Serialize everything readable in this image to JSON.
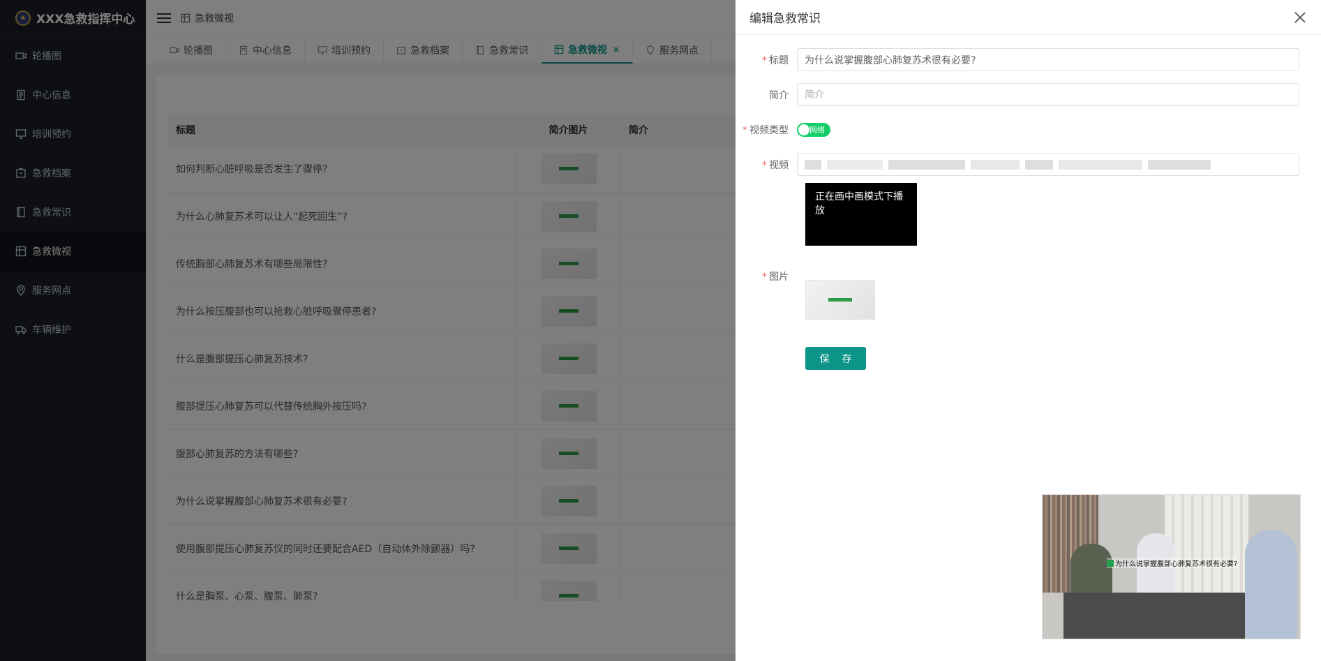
{
  "app": {
    "title": "XXX急救指挥中心"
  },
  "sidebar": {
    "items": [
      {
        "label": "轮播图",
        "icon": "video-icon"
      },
      {
        "label": "中心信息",
        "icon": "document-icon"
      },
      {
        "label": "培训预约",
        "icon": "monitor-icon"
      },
      {
        "label": "急救档案",
        "icon": "box-icon"
      },
      {
        "label": "急救常识",
        "icon": "notebook-icon"
      },
      {
        "label": "急救微视",
        "icon": "grid-icon",
        "active": true
      },
      {
        "label": "服务网点",
        "icon": "location-icon"
      },
      {
        "label": "车辆维护",
        "icon": "truck-icon"
      }
    ]
  },
  "header": {
    "breadcrumb": "急救微视"
  },
  "tabs": [
    {
      "label": "轮播图"
    },
    {
      "label": "中心信息"
    },
    {
      "label": "培训预约"
    },
    {
      "label": "急救档案"
    },
    {
      "label": "急救常识"
    },
    {
      "label": "急救微视",
      "active": true,
      "close": "×"
    },
    {
      "label": "服务网点"
    }
  ],
  "table": {
    "headers": {
      "title": "标题",
      "image": "简介图片",
      "desc": "简介"
    },
    "rows": [
      "如何判断心脏呼吸是否发生了骤停?",
      "为什么心肺复苏术可以让人“起死回生”?",
      "传统胸部心肺复苏术有哪些局限性?",
      "为什么按压腹部也可以抢救心脏呼吸骤停患者?",
      "什么是腹部提压心肺复苏技术?",
      "腹部提压心肺复苏可以代替传统胸外按压吗?",
      "腹部心肺复苏的方法有哪些?",
      "为什么说掌握腹部心肺复苏术很有必要?",
      "使用腹部提压心肺复苏仪的同时还要配合AED（自动体外除颤器）吗?",
      "什么是胸泵、心泵、腹泵、肺泵?"
    ]
  },
  "drawer": {
    "title": "编辑急救常识",
    "fields": {
      "title_label": "标题",
      "title_value": "为什么说掌握腹部心肺复苏术很有必要?",
      "intro_label": "简介",
      "intro_placeholder": "简介",
      "video_type_label": "视频类型",
      "video_type_value": "网络",
      "video_label": "视频",
      "pip_text": "正在画中画模式下播放",
      "image_label": "图片",
      "required_mark": "*"
    },
    "save_label": "保存"
  },
  "video_overlay": {
    "subtitle": "为什么说掌握腹部心肺复苏术很有必要?"
  },
  "colors": {
    "accent": "#0d9488",
    "sidebar_bg": "#1c1f27",
    "switch_on": "#13ce66"
  }
}
